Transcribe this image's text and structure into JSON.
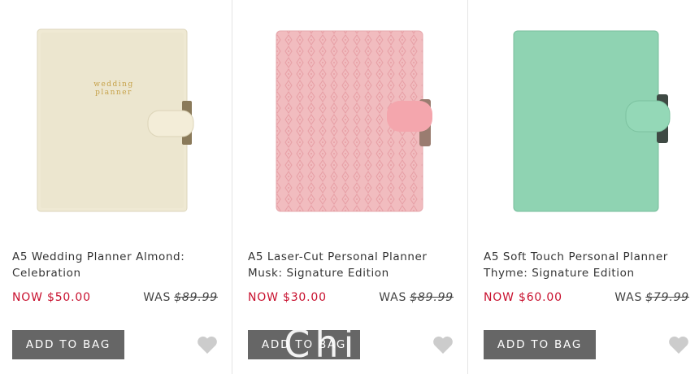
{
  "products": [
    {
      "title_line1": "A5 Wedding Planner Almond:",
      "title_line2": "Celebration",
      "now_label": "NOW",
      "now_price": "$50.00",
      "was_label": "WAS",
      "was_price": "$89.99",
      "add_label": "ADD TO BAG",
      "cover_text_line1": "wedding",
      "cover_text_line2": "planner",
      "cover_color": "#ece6cf",
      "icon": "heart-icon"
    },
    {
      "title_line1": "A5 Laser-Cut Personal Planner",
      "title_line2": "Musk: Signature Edition",
      "now_label": "NOW",
      "now_price": "$30.00",
      "was_label": "WAS",
      "was_price": "$89.99",
      "add_label": "ADD TO BAG",
      "cover_color": "#f1bcbf",
      "icon": "heart-icon"
    },
    {
      "title_line1": "A5 Soft Touch Personal Planner",
      "title_line2": "Thyme: Signature Edition",
      "now_label": "NOW",
      "now_price": "$60.00",
      "was_label": "WAS",
      "was_price": "$79.99",
      "add_label": "ADD TO BAG",
      "cover_color": "#8fd3b2",
      "icon": "heart-icon"
    }
  ],
  "colors": {
    "sale_price": "#c8102e",
    "button_bg": "#666666",
    "heart": "#cccccc"
  },
  "watermark": "China"
}
